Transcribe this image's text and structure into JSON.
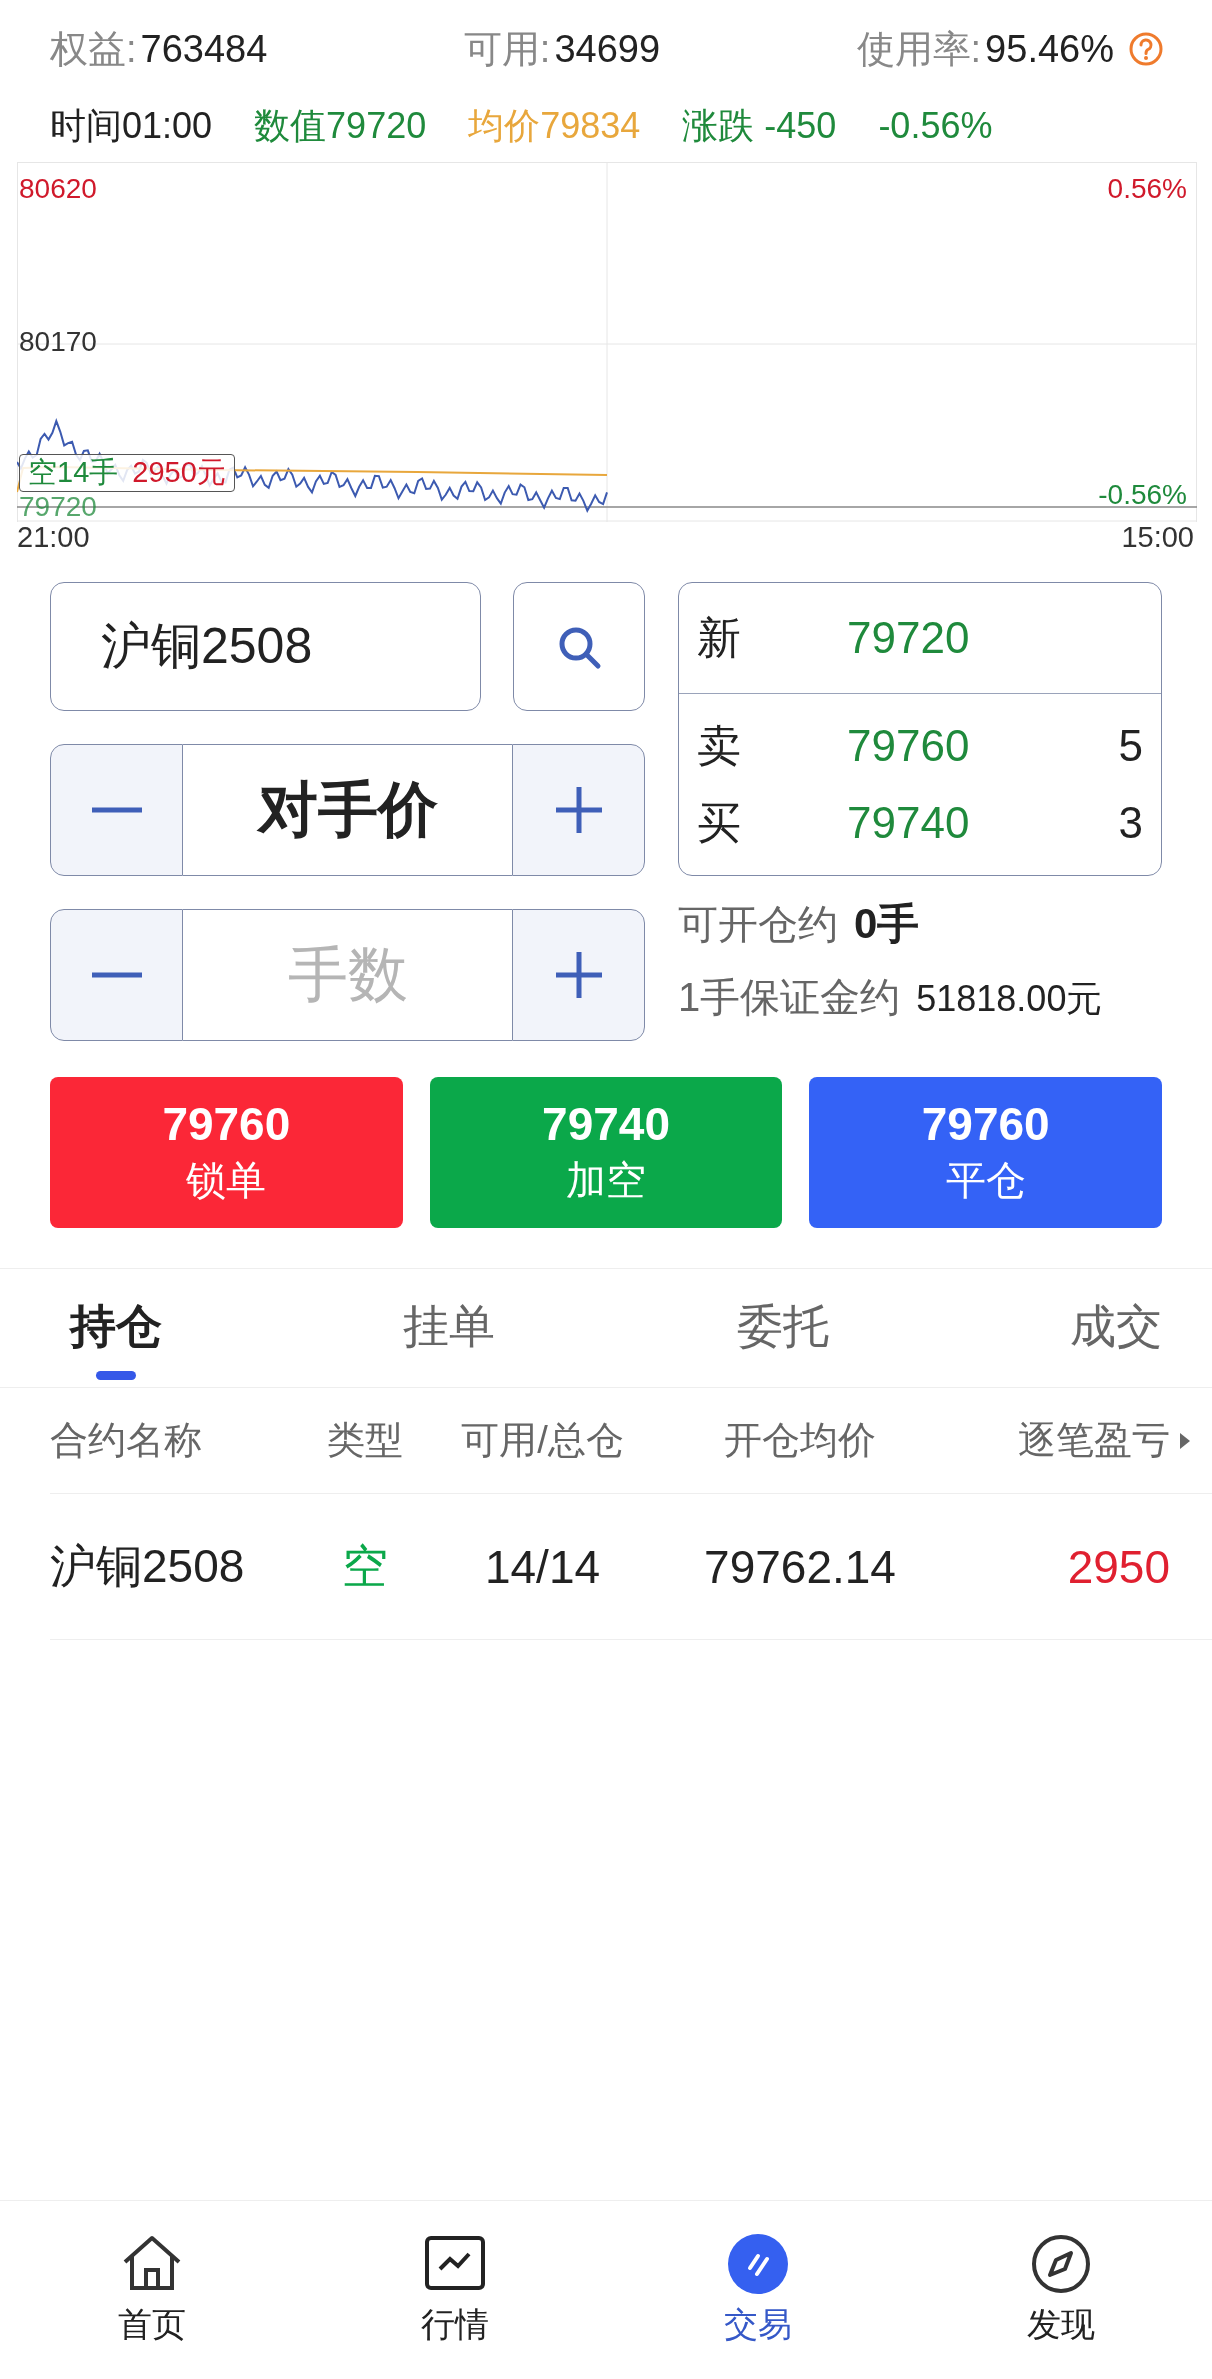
{
  "account": [
    {
      "label": "权益:",
      "value": "763484"
    },
    {
      "label": "可用:",
      "value": "34699"
    },
    {
      "label": "使用率:",
      "value": "95.46%"
    }
  ],
  "quote_line": [
    {
      "text": "时间01:00",
      "kind": "time"
    },
    {
      "text": "数值79720",
      "kind": "value"
    },
    {
      "text": "均价79834",
      "kind": "average"
    },
    {
      "text": "涨跌 -450",
      "kind": "change"
    },
    {
      "text": "-0.56%",
      "kind": "change"
    }
  ],
  "chart": {
    "y_left": [
      {
        "text": "80620",
        "kind": "up"
      },
      {
        "text": "80170",
        "kind": "flat"
      },
      {
        "text": "79720",
        "kind": "down"
      }
    ],
    "y_right": [
      {
        "text": "0.56%",
        "kind": "up"
      },
      {
        "text": "-0.56%",
        "kind": "down"
      }
    ],
    "x_labels": [
      "21:00",
      "15:00"
    ],
    "position_tag": {
      "side": "空14手",
      "profit": "2950元"
    }
  },
  "order": {
    "contract": {
      "value": "沪铜2508"
    },
    "price": {
      "value": "对手价"
    },
    "quantity": {
      "placeholder": "手数"
    },
    "quote": [
      {
        "label": "新",
        "price": "79720"
      },
      {
        "label": "卖",
        "price": "79760",
        "volume": "5"
      },
      {
        "label": "买",
        "price": "79740",
        "volume": "3"
      }
    ],
    "openable": {
      "label": "可开仓约",
      "value": "0手"
    },
    "margin": {
      "label": "1手保证金约",
      "value": "51818.00元"
    }
  },
  "actions": [
    {
      "price": "79760",
      "label": "锁单",
      "kind": "lock"
    },
    {
      "price": "79740",
      "label": "加空",
      "kind": "short"
    },
    {
      "price": "79760",
      "label": "平仓",
      "kind": "close"
    }
  ],
  "tabs": [
    {
      "label": "持仓",
      "selected": true
    },
    {
      "label": "挂单",
      "selected": false
    },
    {
      "label": "委托",
      "selected": false
    },
    {
      "label": "成交",
      "selected": false
    }
  ],
  "table": {
    "columns": [
      "合约名称",
      "类型",
      "可用/总仓",
      "开仓均价",
      "逐笔盈亏"
    ],
    "rows": [
      {
        "cells": [
          "沪铜2508",
          "空",
          "14/14",
          "79762.14",
          "2950"
        ]
      }
    ]
  },
  "bottom_nav": [
    {
      "label": "首页",
      "kind": "home",
      "selected": false
    },
    {
      "label": "行情",
      "kind": "market",
      "selected": false
    },
    {
      "label": "交易",
      "kind": "trade",
      "selected": true
    },
    {
      "label": "发现",
      "kind": "discover",
      "selected": false
    }
  ]
}
